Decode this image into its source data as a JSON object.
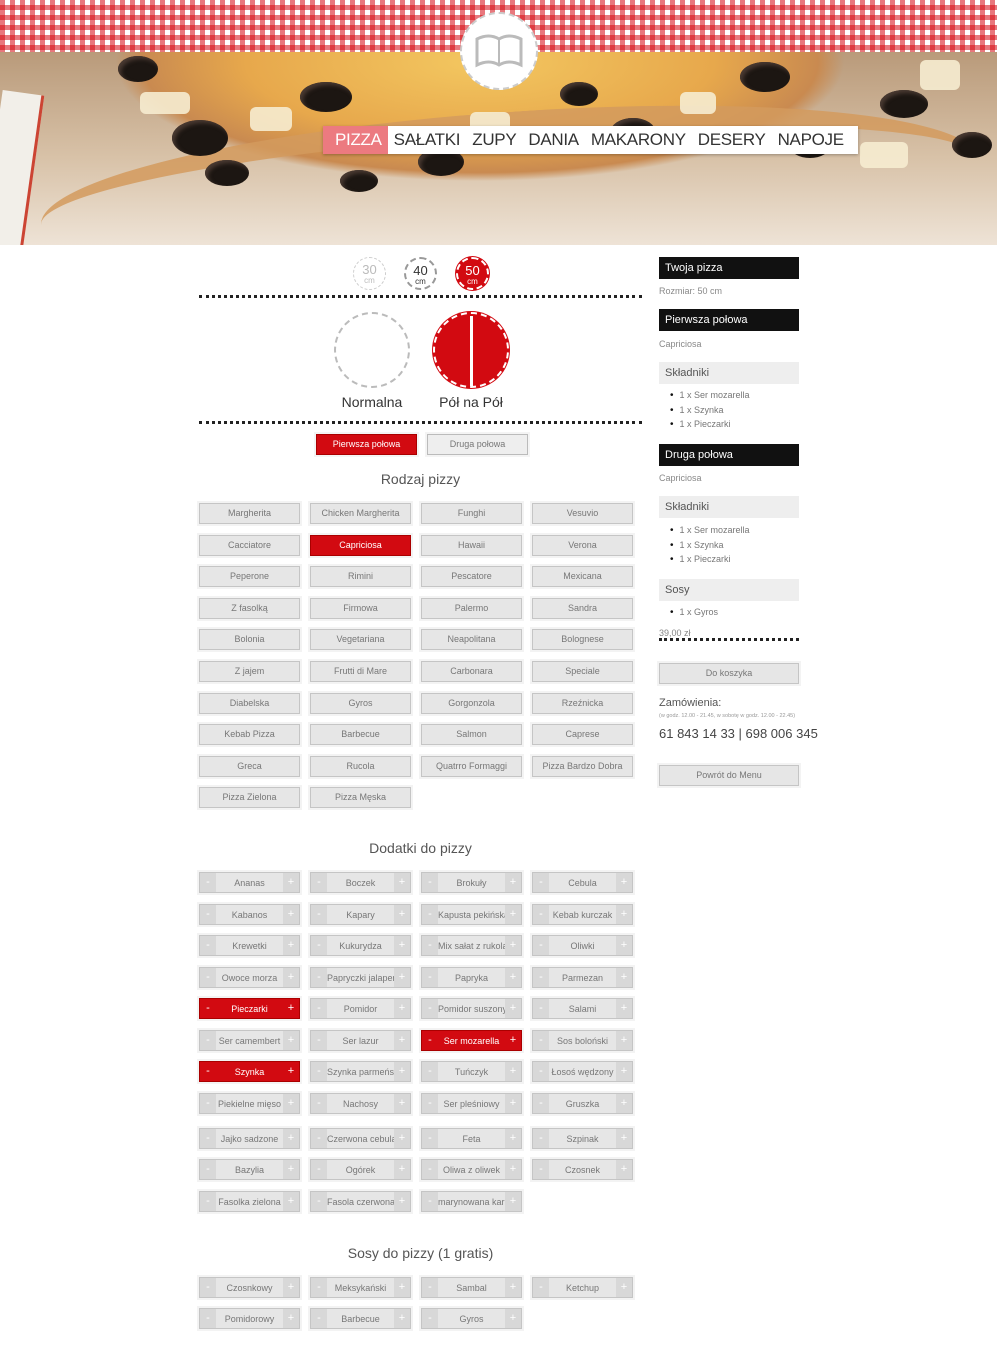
{
  "categories": [
    "PIZZA",
    "SAŁATKI",
    "ZUPY",
    "DANIA",
    "MAKARONY",
    "DESERY",
    "NAPOJE"
  ],
  "sizes": [
    {
      "value": "30",
      "unit": "cm"
    },
    {
      "value": "40",
      "unit": "cm"
    },
    {
      "value": "50",
      "unit": "cm"
    }
  ],
  "pizza_types": {
    "normal": "Normalna",
    "half": "Pół na Pół"
  },
  "half_buttons": {
    "first": "Pierwsza połowa",
    "second": "Druga połowa"
  },
  "pizza_section_title": "Rodzaj pizzy",
  "pizzas": [
    "Margherita",
    "Chicken Margherita",
    "Funghi",
    "Vesuvio",
    "Cacciatore",
    "Capriciosa",
    "Hawaii",
    "Verona",
    "Peperone",
    "Rimini",
    "Pescatore",
    "Mexicana",
    "Z fasolką",
    "Firmowa",
    "Palermo",
    "Sandra",
    "Bolonia",
    "Vegetariana",
    "Neapolitana",
    "Bolognese",
    "Z jajem",
    "Frutti di Mare",
    "Carbonara",
    "Speciale",
    "Diabelska",
    "Gyros",
    "Gorgonzola",
    "Rzeźnicka",
    "Kebab Pizza",
    "Barbecue",
    "Salmon",
    "Caprese",
    "Greca",
    "Rucola",
    "Quatrro Formaggi",
    "Pizza Bardzo Dobra",
    "Pizza Zielona",
    "Pizza Męska"
  ],
  "addons_section_title": "Dodatki do pizzy",
  "addons": [
    "Ananas",
    "Boczek",
    "Brokuły",
    "Cebula",
    "Kabanos",
    "Kapary",
    "Kapusta pekińska",
    "Kebab kurczak",
    "Krewetki",
    "Kukurydza",
    "Mix sałat z rukolą",
    "Oliwki",
    "Owoce morza",
    "Papryczki jalapeno",
    "Papryka",
    "Parmezan",
    "Pieczarki",
    "Pomidor",
    "Pomidor suszony",
    "Salami",
    "Ser camembert",
    "Ser lazur",
    "Ser mozarella",
    "Sos boloński",
    "Szynka",
    "Szynka parmeńska",
    "Tuńczyk",
    "Łosoś wędzony",
    "Piekielne mięso",
    "Nachosy",
    "Ser pleśniowy",
    "Gruszka",
    "Jajko sadzone",
    "Czerwona cebula",
    "Feta",
    "Szpinak",
    "Bazylia",
    "Ogórek",
    "Oliwa z oliwek",
    "Czosnek",
    "Fasolka zielona",
    "Fasola czerwona",
    "marynowana karkówka"
  ],
  "sauces_section_title": "Sosy do pizzy (1 gratis)",
  "sauces": [
    "Czosnkowy",
    "Meksykański",
    "Sambal",
    "Ketchup",
    "Pomidorowy",
    "Barbecue",
    "Gyros"
  ],
  "sidebar": {
    "your_pizza": "Twoja pizza",
    "size": "Rozmiar: 50 cm",
    "first_half": "Pierwsza połowa",
    "first_name": "Capriciosa",
    "ingredients_label": "Składniki",
    "first_ingredients": [
      "1 x Ser mozarella",
      "1 x Szynka",
      "1 x Pieczarki"
    ],
    "second_half": "Druga połowa",
    "second_name": "Capriciosa",
    "second_ingredients": [
      "1 x Ser mozarella",
      "1 x Szynka",
      "1 x Pieczarki"
    ],
    "sauces_label": "Sosy",
    "sauces": [
      "1 x Gyros"
    ],
    "price": "39,00 zł",
    "cart_button": "Do koszyka",
    "orders_label": "Zamówienia:",
    "orders_hours": "(w godz. 12.00 - 21.45, w sobotę w godz. 12.00 - 22.45)",
    "phones": "61 843 14 33 | 698 006 345",
    "back_button": "Powrót do Menu"
  },
  "colors": {
    "accent": "#d20a11",
    "nav_active": "#ec7a80"
  }
}
